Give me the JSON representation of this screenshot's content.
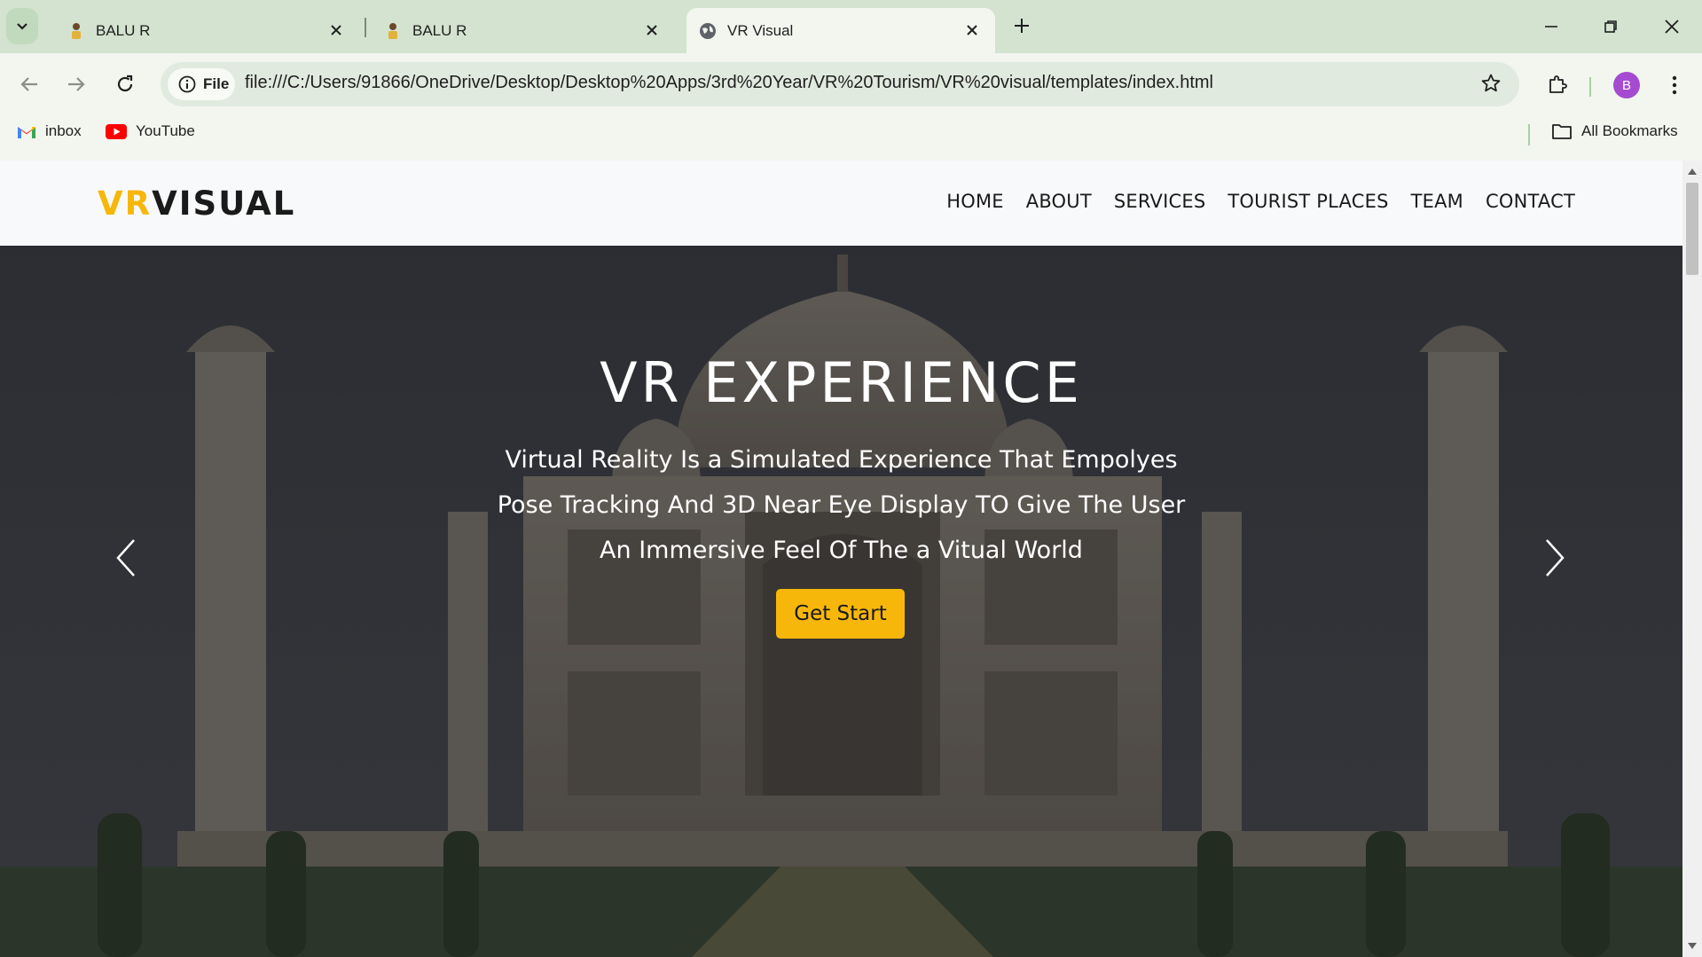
{
  "browser": {
    "tabs": [
      {
        "title": "BALU R",
        "favicon": "person-icon",
        "active": false
      },
      {
        "title": "BALU R",
        "favicon": "person-icon",
        "active": false
      },
      {
        "title": "VR Visual",
        "favicon": "globe-icon",
        "active": true
      }
    ],
    "site_info_label": "File",
    "url": "file:///C:/Users/91866/OneDrive/Desktop/Desktop%20Apps/3rd%20Year/VR%20Tourism/VR%20visual/templates/index.html",
    "profile_initial": "B",
    "bookmarks": [
      {
        "label": "inbox",
        "icon": "gmail-icon"
      },
      {
        "label": "YouTube",
        "icon": "youtube-icon"
      }
    ],
    "all_bookmarks_label": "All Bookmarks"
  },
  "site": {
    "logo": {
      "part1": "VR",
      "part2": "VISUAL"
    },
    "nav": [
      "HOME",
      "ABOUT",
      "SERVICES",
      "TOURIST PLACES",
      "TEAM",
      "CONTACT"
    ],
    "hero": {
      "title": "VR EXPERIENCE",
      "lines": [
        "Virtual Reality Is a Simulated Experience That Empolyes",
        "Pose Tracking And 3D Near Eye Display TO Give The User",
        "An Immersive Feel Of The a Vitual World"
      ],
      "cta_label": "Get Start"
    }
  },
  "colors": {
    "accent": "#f7b70a",
    "chrome_tabstrip": "#d3e3d0",
    "chrome_toolbar": "#f2f6ef",
    "avatar": "#a54bd1"
  }
}
